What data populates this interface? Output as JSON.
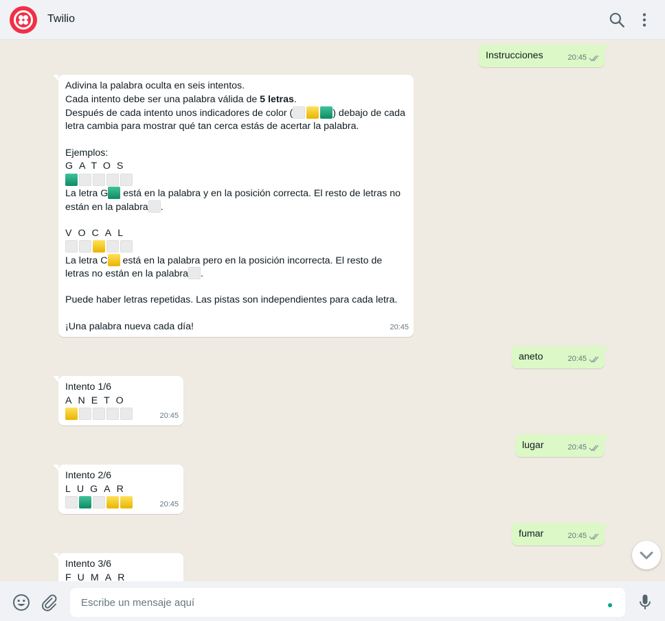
{
  "header": {
    "title": "Twilio",
    "avatar_icon": "twilio-logo-icon",
    "search_icon": "search-icon",
    "menu_icon": "more-vertical-icon"
  },
  "colors": {
    "accent": "#f22f46",
    "outgoing_bubble": "#dcf8c6",
    "incoming_bubble": "#ffffff",
    "tile_green": "#1aa179",
    "tile_yellow": "#f5c518",
    "tile_gray": "#eaeaea"
  },
  "messages": {
    "m1": {
      "direction": "outgoing",
      "text": "Instrucciones",
      "time": "20:45",
      "status": "read"
    },
    "m2": {
      "direction": "incoming",
      "time": "20:45",
      "l1": "Adivina la palabra oculta en seis intentos.",
      "l2a": "Cada intento debe ser una palabra válida de ",
      "l2b": "5 letras",
      "l2c": ".",
      "l3a": "Después de cada intento unos indicadores de color (",
      "l3b": ") debajo de cada",
      "l4": "letra cambia para mostrar qué tan cerca estás de acertar la palabra.",
      "ejemplos": "Ejemplos:",
      "ex1_word": "GATOS",
      "ex1_tiles": [
        "green",
        "gray",
        "gray",
        "gray",
        "gray"
      ],
      "ex1_a": "La letra G",
      "ex1_b": " está en la palabra y en la posición correcta. El resto de letras no",
      "ex1_c": "están en la palabra",
      "ex1_d": ".",
      "ex2_word": "VOCAL",
      "ex2_tiles": [
        "gray",
        "gray",
        "yellow",
        "gray",
        "gray"
      ],
      "ex2_a": "La letra C",
      "ex2_b": " está en la palabra pero en la posición incorrecta. El resto de",
      "ex2_c": "letras no están en la palabra",
      "ex2_d": ".",
      "repetidas": "Puede haber letras repetidas. Las pistas son independientes para cada letra.",
      "nueva": "¡Una palabra nueva cada día!"
    },
    "m3": {
      "direction": "outgoing",
      "text": "aneto",
      "time": "20:45",
      "status": "read"
    },
    "m4": {
      "direction": "incoming",
      "title": "Intento 1/6",
      "word": "ANETO",
      "tiles": [
        "yellow",
        "gray",
        "gray",
        "gray",
        "gray"
      ],
      "time": "20:45"
    },
    "m5": {
      "direction": "outgoing",
      "text": "lugar",
      "time": "20:45",
      "status": "read"
    },
    "m6": {
      "direction": "incoming",
      "title": "Intento 2/6",
      "word": "LUGAR",
      "tiles": [
        "gray",
        "green",
        "gray",
        "yellow",
        "yellow"
      ],
      "time": "20:45"
    },
    "m7": {
      "direction": "outgoing",
      "text": "fumar",
      "time": "20:45",
      "status": "read"
    },
    "m8": {
      "direction": "incoming",
      "title": "Intento 3/6",
      "word": "FUMAR"
    }
  },
  "scroll_button_icon": "chevron-down-icon",
  "composer": {
    "placeholder": "Escribe un mensaje aquí",
    "value": "",
    "emoji_icon": "emoji-icon",
    "attach_icon": "paperclip-icon",
    "mic_icon": "microphone-icon"
  }
}
